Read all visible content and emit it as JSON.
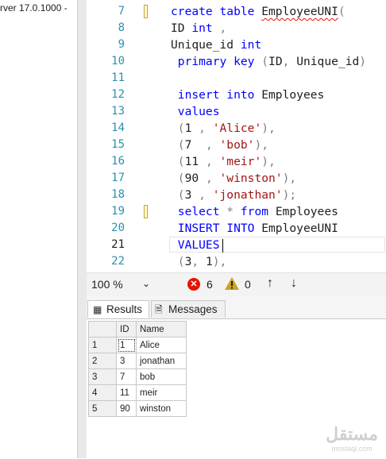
{
  "explorer": {
    "server_label": "rver 17.0.1000 -"
  },
  "editor": {
    "lines": [
      {
        "num": "7",
        "segments": [
          [
            "kw",
            "create table "
          ],
          [
            "sq",
            "EmployeeUNI"
          ],
          [
            "gray",
            "("
          ]
        ]
      },
      {
        "num": "8",
        "segments": [
          [
            "",
            "ID "
          ],
          [
            "kw",
            "int"
          ],
          [
            "gray",
            " ,"
          ]
        ]
      },
      {
        "num": "9",
        "segments": [
          [
            "",
            "Unique_id "
          ],
          [
            "kw",
            "int"
          ]
        ]
      },
      {
        "num": "10",
        "segments": [
          [
            "kw",
            " primary key "
          ],
          [
            "gray",
            "("
          ],
          [
            "",
            "ID"
          ],
          [
            "gray",
            ", "
          ],
          [
            "",
            "Unique_id"
          ],
          [
            "gray",
            ")"
          ]
        ]
      },
      {
        "num": "11",
        "segments": []
      },
      {
        "num": "12",
        "segments": [
          [
            "kw",
            " insert into "
          ],
          [
            "",
            "Employees"
          ]
        ]
      },
      {
        "num": "13",
        "segments": [
          [
            "kw",
            " values"
          ]
        ]
      },
      {
        "num": "14",
        "segments": [
          [
            "gray",
            " ("
          ],
          [
            "",
            "1 "
          ],
          [
            "gray",
            ", "
          ],
          [
            "str",
            "'Alice'"
          ],
          [
            "gray",
            "),"
          ]
        ]
      },
      {
        "num": "15",
        "segments": [
          [
            "gray",
            " ("
          ],
          [
            "",
            "7  "
          ],
          [
            "gray",
            ", "
          ],
          [
            "str",
            "'bob'"
          ],
          [
            "gray",
            "),"
          ]
        ]
      },
      {
        "num": "16",
        "segments": [
          [
            "gray",
            " ("
          ],
          [
            "",
            "11 "
          ],
          [
            "gray",
            ", "
          ],
          [
            "str",
            "'meir'"
          ],
          [
            "gray",
            "),"
          ]
        ]
      },
      {
        "num": "17",
        "segments": [
          [
            "gray",
            " ("
          ],
          [
            "",
            "90 "
          ],
          [
            "gray",
            ", "
          ],
          [
            "str",
            "'winston'"
          ],
          [
            "gray",
            "),"
          ]
        ]
      },
      {
        "num": "18",
        "segments": [
          [
            "gray",
            " ("
          ],
          [
            "",
            "3 "
          ],
          [
            "gray",
            ", "
          ],
          [
            "str",
            "'jonathan'"
          ],
          [
            "gray",
            ");"
          ]
        ]
      },
      {
        "num": "19",
        "segments": [
          [
            "kw",
            " select "
          ],
          [
            "gray",
            "* "
          ],
          [
            "kw",
            "from "
          ],
          [
            "",
            "Employees"
          ]
        ]
      },
      {
        "num": "20",
        "segments": [
          [
            "kw",
            " INSERT INTO "
          ],
          [
            "",
            "EmployeeUNI"
          ]
        ]
      },
      {
        "num": "21",
        "segments": [
          [
            "kw",
            " VALUES"
          ]
        ]
      },
      {
        "num": "22",
        "segments": [
          [
            "gray",
            " ("
          ],
          [
            "",
            "3"
          ],
          [
            "gray",
            ", "
          ],
          [
            "",
            "1"
          ],
          [
            "gray",
            "),"
          ]
        ]
      }
    ]
  },
  "statusbar": {
    "zoom": "100 %",
    "errors": "6",
    "warnings": "0"
  },
  "results": {
    "tab_results": "Results",
    "tab_messages": "Messages",
    "columns": [
      "ID",
      "Name"
    ],
    "rows": [
      {
        "row": "1",
        "id": "1",
        "name": "Alice"
      },
      {
        "row": "2",
        "id": "3",
        "name": "jonathan"
      },
      {
        "row": "3",
        "id": "7",
        "name": "bob"
      },
      {
        "row": "4",
        "id": "11",
        "name": "meir"
      },
      {
        "row": "5",
        "id": "90",
        "name": "winston"
      }
    ]
  },
  "watermark": {
    "line1": "مستقل",
    "line2": "mostaql.com"
  },
  "colors": {
    "keyword": "#0000ff",
    "string": "#a31515",
    "line_number": "#2b91af",
    "error": "#e51400",
    "warning": "#c9a227"
  },
  "icons": [
    "results-grid-icon",
    "messages-icon",
    "error-icon",
    "warning-icon",
    "arrow-up-icon",
    "arrow-down-icon",
    "chevron-down-icon"
  ]
}
